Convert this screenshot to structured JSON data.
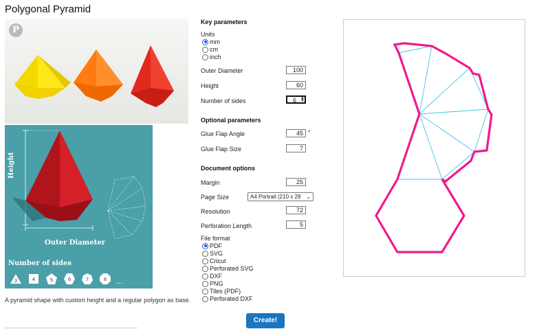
{
  "page": {
    "title": "Polygonal Pyramid",
    "caption": "A pyramid shape with custom height and a regular polygon as base."
  },
  "diagram": {
    "height_label": "Height",
    "diameter_label": "Outer Diameter",
    "sides_label": "Number of sides",
    "side_counts": [
      "3",
      "4",
      "5",
      "6",
      "7",
      "8"
    ],
    "more": "..."
  },
  "key_params": {
    "heading": "Key parameters",
    "units_label": "Units",
    "units": [
      {
        "label": "mm",
        "checked": true
      },
      {
        "label": "cm",
        "checked": false
      },
      {
        "label": "inch",
        "checked": false
      }
    ],
    "outer_diameter": {
      "label": "Outer Diameter",
      "value": "100"
    },
    "height": {
      "label": "Height",
      "value": "60"
    },
    "sides": {
      "label": "Number of sides",
      "value": "6"
    }
  },
  "optional_params": {
    "heading": "Optional parameters",
    "flap_angle": {
      "label": "Glue Flap Angle",
      "value": "45",
      "unit": "°"
    },
    "flap_size": {
      "label": "Glue Flap Size",
      "value": "7"
    }
  },
  "doc_options": {
    "heading": "Document options",
    "margin": {
      "label": "Margin",
      "value": "25"
    },
    "page_size": {
      "label": "Page Size",
      "value": "A4 Portrait (210 x 29"
    },
    "resolution": {
      "label": "Resolution",
      "value": "72"
    },
    "perforation": {
      "label": "Perforation Length",
      "value": "5"
    },
    "format_label": "File format",
    "formats": [
      {
        "label": "PDF",
        "checked": true
      },
      {
        "label": "SVG",
        "checked": false
      },
      {
        "label": "Cricut",
        "checked": false
      },
      {
        "label": "Perforated SVG",
        "checked": false
      },
      {
        "label": "DXF",
        "checked": false
      },
      {
        "label": "PNG",
        "checked": false
      },
      {
        "label": "Tiles (PDF)",
        "checked": false
      },
      {
        "label": "Perforated DXF",
        "checked": false
      }
    ]
  },
  "create_label": "Create!",
  "colors": {
    "net_outline": "#f0198c",
    "net_fold": "#3ec3e6",
    "accent": "#1976c2",
    "diagram_bg": "#4a9fa8"
  }
}
